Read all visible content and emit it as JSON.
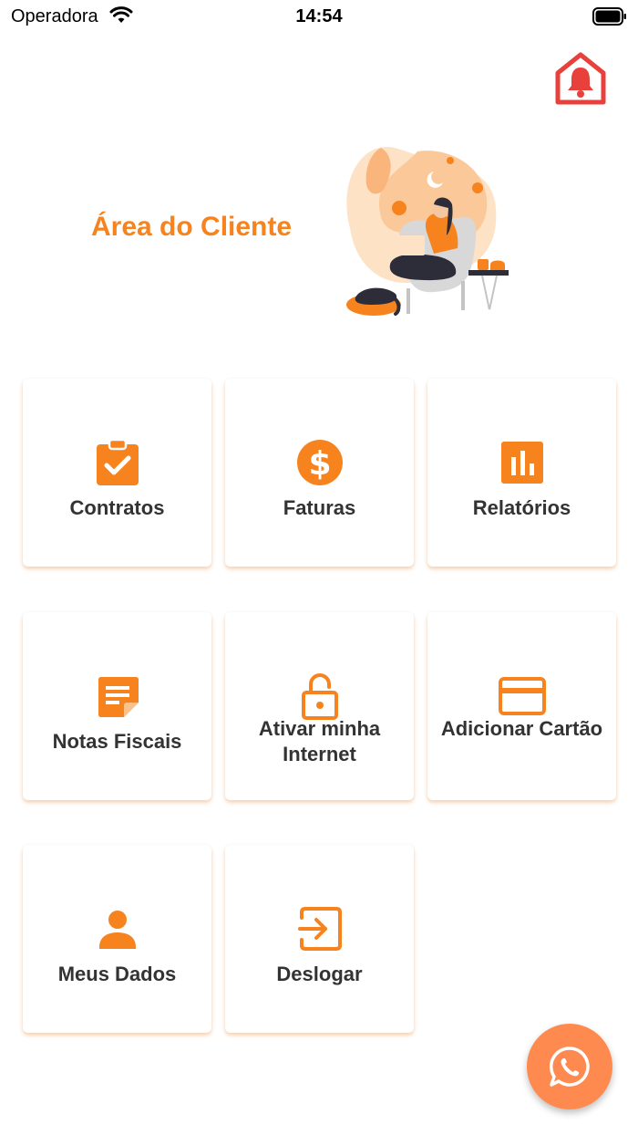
{
  "status_bar": {
    "carrier": "Operadora",
    "time": "14:54"
  },
  "header": {
    "title": "Área do Cliente",
    "alarm_icon": "house-bell-icon"
  },
  "colors": {
    "accent": "#f7831f",
    "whatsapp": "#ff8a4f",
    "alarm": "#e8403a"
  },
  "menu": [
    {
      "label": "Contratos",
      "icon": "clipboard-check-icon"
    },
    {
      "label": "Faturas",
      "icon": "dollar-circle-icon"
    },
    {
      "label": "Relatórios",
      "icon": "bar-chart-icon"
    },
    {
      "label": "Notas Fiscais",
      "icon": "note-icon"
    },
    {
      "label": "Ativar minha Internet",
      "icon": "lock-open-icon"
    },
    {
      "label": "Adicionar Cartão",
      "icon": "credit-card-icon"
    },
    {
      "label": "Meus Dados",
      "icon": "person-icon"
    },
    {
      "label": "Deslogar",
      "icon": "logout-icon"
    }
  ],
  "fab": {
    "icon": "whatsapp-icon"
  }
}
